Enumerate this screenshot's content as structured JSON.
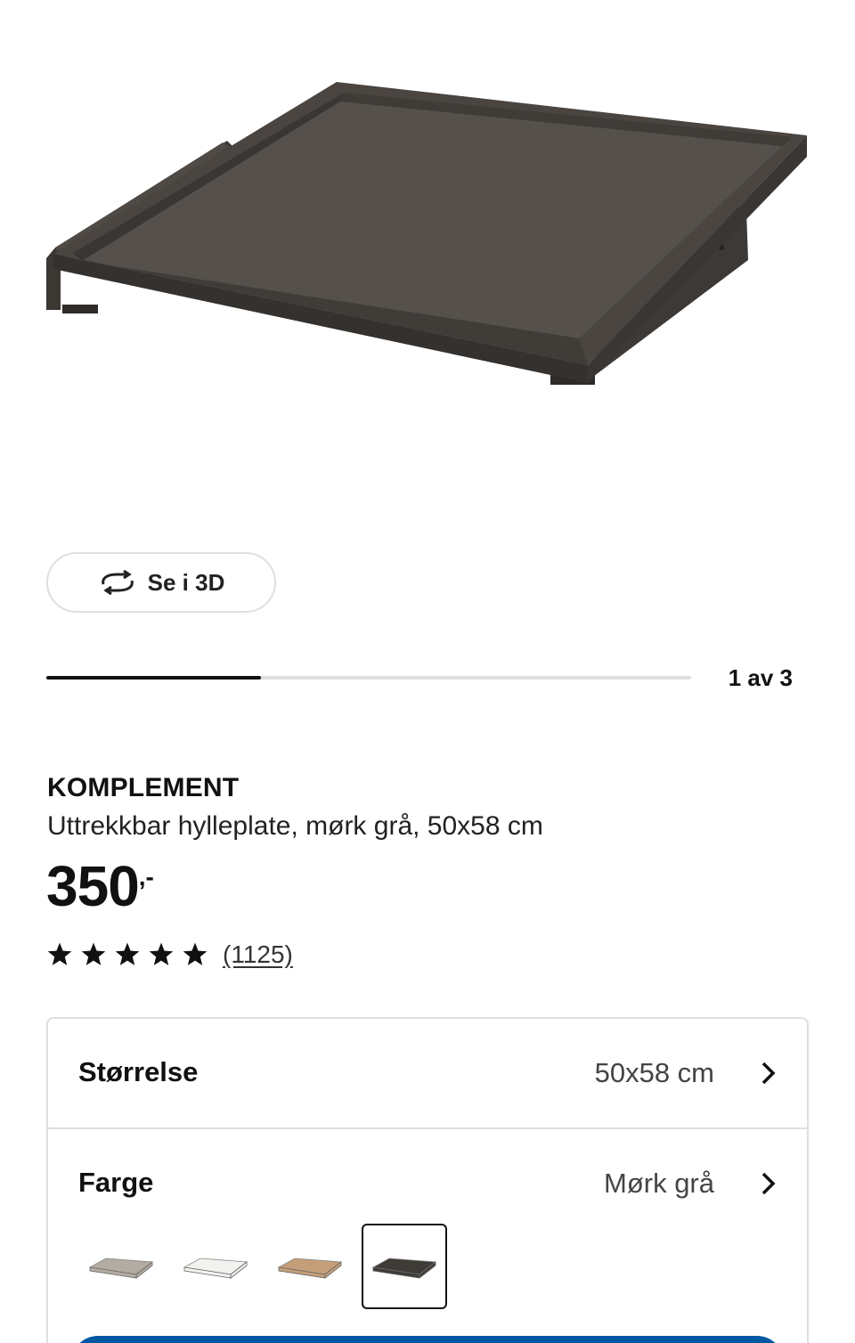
{
  "product": {
    "name": "KOMPLEMENT",
    "description": "Uttrekkbar hylleplate, mørk grå, 50x58 cm",
    "price": "350",
    "price_suffix": ",-",
    "rating": {
      "stars": 5,
      "max_stars": 5,
      "review_count": "(1125)"
    }
  },
  "gallery": {
    "view_3d_label": "Se i 3D",
    "counter": "1 av 3",
    "progress_fraction": 0.333,
    "image_icon": "pull-out-shelf-dark-grey"
  },
  "options": {
    "size": {
      "label": "Størrelse",
      "value": "50x58 cm"
    },
    "color": {
      "label": "Farge",
      "value": "Mørk grå",
      "swatches": [
        {
          "name": "grey-beige",
          "color": "#b3aca2",
          "selected": false
        },
        {
          "name": "white",
          "color": "#f2f2ef",
          "selected": false
        },
        {
          "name": "white-stained-oak",
          "color": "#c49e78",
          "selected": false
        },
        {
          "name": "dark-grey",
          "color": "#3f3b37",
          "selected": true
        }
      ]
    }
  },
  "colors": {
    "accent": "#0058a3",
    "text": "#111111",
    "border": "#dfdfdf"
  }
}
